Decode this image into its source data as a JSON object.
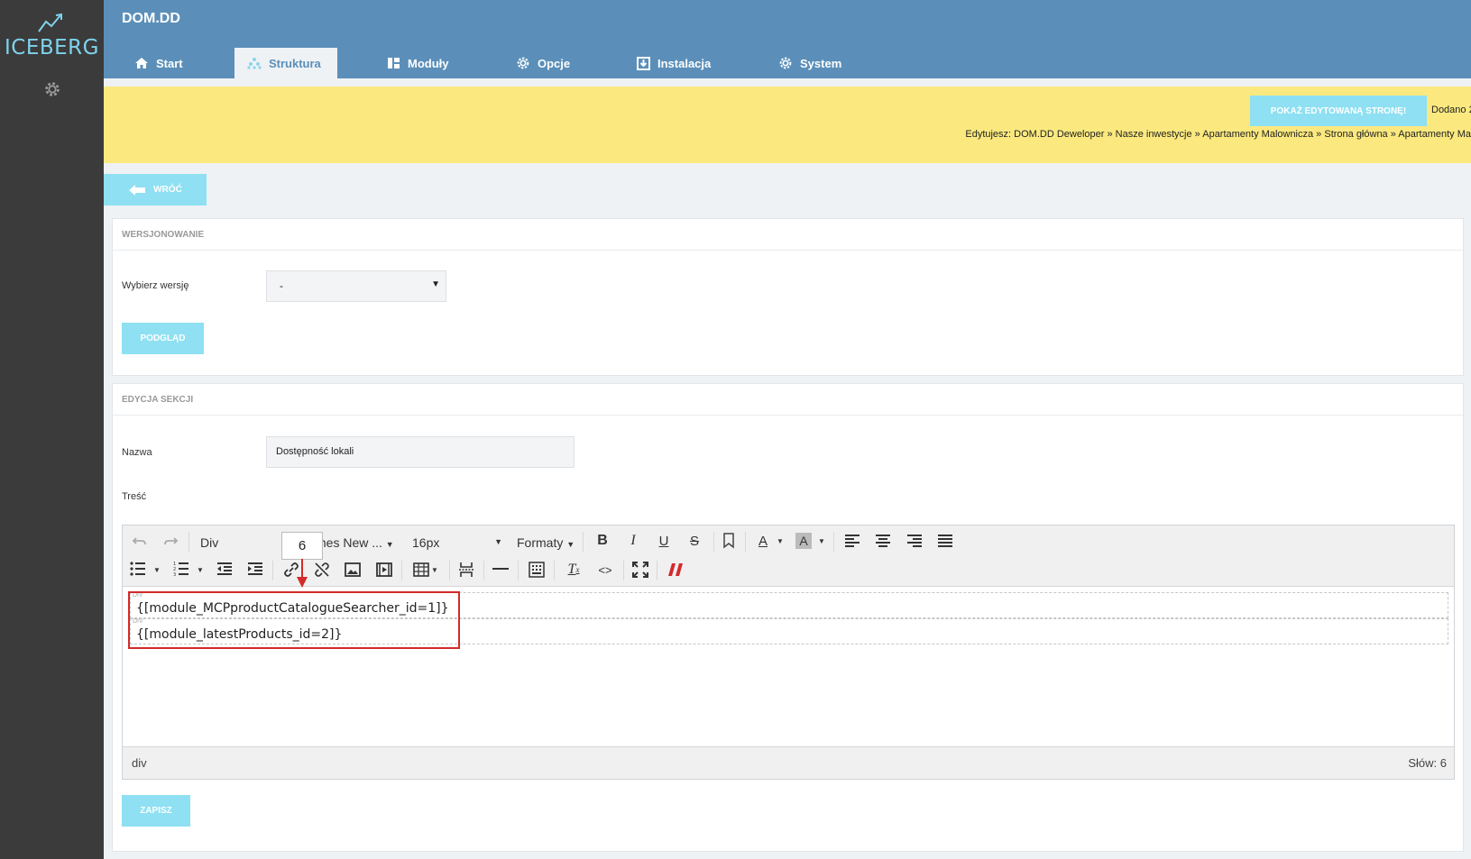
{
  "sidebar": {
    "logo_text": "ICEBERG"
  },
  "header": {
    "site_name": "DOM.DD",
    "tabs": [
      {
        "label": "Start",
        "icon": "home-icon"
      },
      {
        "label": "Struktura",
        "icon": "sitemap-icon",
        "active": true
      },
      {
        "label": "Moduły",
        "icon": "modules-icon"
      },
      {
        "label": "Opcje",
        "icon": "gear-icon"
      },
      {
        "label": "Instalacja",
        "icon": "install-icon"
      },
      {
        "label": "System",
        "icon": "gear-icon"
      }
    ]
  },
  "notice": {
    "show_page_button": "POKAŻ EDYTOWANĄ STRONĘ!",
    "added_text": "Dodano 2",
    "breadcrumb": "Edytujesz: DOM.DD Deweloper » Nasze inwestycje » Apartamenty Malownicza » Strona główna » Apartamenty Ma"
  },
  "back_button": "WRÓĆ",
  "versioning": {
    "title": "WERSJONOWANIE",
    "version_label": "Wybierz wersję",
    "version_value": "-",
    "preview_button": "PODGLĄD"
  },
  "section_edit": {
    "title": "EDYCJA SEKCJI",
    "name_label": "Nazwa",
    "name_value": "Dostępność lokali",
    "content_label": "Treść",
    "save_button": "ZAPISZ"
  },
  "editor": {
    "block_format": "Div",
    "font_family": "mes New ...",
    "font_size": "16px",
    "formats": "Formaty",
    "tooltip_value": "6",
    "div_tag": "DIV",
    "lines": [
      "{[module_MCPproductCatalogueSearcher_id=1]}",
      "{[module_latestProducts_id=2]}"
    ],
    "status_path": "div",
    "word_count": "Słów: 6"
  },
  "colors": {
    "topbar": "#5b8fb9",
    "sidebar": "#3b3b3b",
    "accent_cyan": "#8ee0f2",
    "notice_yellow": "#fbe97f",
    "highlight_red": "#d32a2a"
  }
}
